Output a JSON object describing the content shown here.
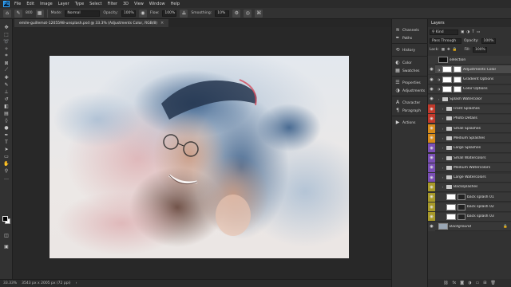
{
  "menubar": {
    "logo": "Ps",
    "items": [
      "File",
      "Edit",
      "Image",
      "Layer",
      "Type",
      "Select",
      "Filter",
      "3D",
      "View",
      "Window",
      "Help"
    ]
  },
  "options": {
    "mode_label": "Mode:",
    "mode_value": "Normal",
    "opacity_label": "Opacity:",
    "opacity_value": "100%",
    "flow_label": "Flow:",
    "flow_value": "100%",
    "smoothing_label": "Smoothing:",
    "smoothing_value": "10%",
    "brush_size": "800"
  },
  "document": {
    "tab_title": "emile-guillemot-1205598-unsplash.psd @ 33.3% (Adjustments Color, RGB/8)",
    "close": "×"
  },
  "status": {
    "zoom": "33.33%",
    "doc_size": "3543 px x 2005 px (72 ppi)"
  },
  "side_panels": [
    {
      "label": "Channels",
      "icon": "channels-icon"
    },
    {
      "label": "Paths",
      "icon": "paths-icon"
    },
    {
      "label": "History",
      "icon": "history-icon"
    },
    {
      "label": "Color",
      "icon": "color-icon"
    },
    {
      "label": "Swatches",
      "icon": "swatches-icon"
    },
    {
      "label": "Properties",
      "icon": "properties-icon"
    },
    {
      "label": "Adjustments",
      "icon": "adjustments-icon"
    },
    {
      "label": "Character",
      "icon": "character-icon"
    },
    {
      "label": "Paragraph",
      "icon": "paragraph-icon"
    },
    {
      "label": "Actions",
      "icon": "actions-icon"
    }
  ],
  "layers_panel": {
    "title": "Layers",
    "filter_kind": "Kind",
    "blend_mode": "Pass Through",
    "opacity_label": "Opacity:",
    "opacity_value": "100%",
    "lock_label": "Lock:",
    "fill_label": "Fill:",
    "fill_value": "100%",
    "layers": [
      {
        "name": "selection",
        "type": "layer",
        "color": "#383838",
        "visible": false,
        "level": 0
      },
      {
        "name": "Adjustments Color",
        "type": "adjust",
        "color": "#383838",
        "visible": true,
        "level": 0,
        "selected": true
      },
      {
        "name": "Gradient Options",
        "type": "adjust",
        "color": "#383838",
        "visible": true,
        "level": 0
      },
      {
        "name": "Color Options",
        "type": "adjust",
        "color": "#383838",
        "visible": true,
        "level": 0
      },
      {
        "name": "Splash Watercolor",
        "type": "group",
        "color": "#383838",
        "visible": true,
        "level": 0
      },
      {
        "name": "Front Splashes",
        "type": "group",
        "color": "#c0392b",
        "visible": true,
        "level": 1
      },
      {
        "name": "Photo Details",
        "type": "group",
        "color": "#c0392b",
        "visible": true,
        "level": 1
      },
      {
        "name": "Small Splashes",
        "type": "group",
        "color": "#d68a1a",
        "visible": true,
        "level": 1
      },
      {
        "name": "Medium Splashes",
        "type": "group",
        "color": "#d68a1a",
        "visible": true,
        "level": 1
      },
      {
        "name": "Large Splashes",
        "type": "group",
        "color": "#7a4fb5",
        "visible": true,
        "level": 1
      },
      {
        "name": "Small Watercolors",
        "type": "group",
        "color": "#7a4fb5",
        "visible": true,
        "level": 1
      },
      {
        "name": "Medium Watercolors",
        "type": "group",
        "color": "#7a4fb5",
        "visible": true,
        "level": 1
      },
      {
        "name": "Large Watercolors",
        "type": "group",
        "color": "#7a4fb5",
        "visible": true,
        "level": 1
      },
      {
        "name": "Backsplashes",
        "type": "group",
        "color": "#a89a2a",
        "visible": true,
        "level": 1
      },
      {
        "name": "back splash 01",
        "type": "layer",
        "color": "#a89a2a",
        "visible": true,
        "level": 2
      },
      {
        "name": "back splash 02",
        "type": "layer",
        "color": "#a89a2a",
        "visible": true,
        "level": 2
      },
      {
        "name": "back splash 03",
        "type": "layer",
        "color": "#a89a2a",
        "visible": true,
        "level": 2
      },
      {
        "name": "Background",
        "type": "bg",
        "color": "#383838",
        "visible": true,
        "level": 0
      }
    ]
  }
}
